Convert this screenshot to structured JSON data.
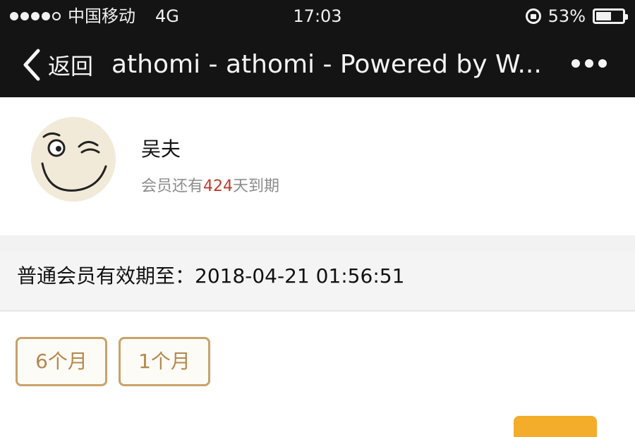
{
  "status_bar": {
    "carrier": "中国移动",
    "network": "4G",
    "time": "17:03",
    "battery_percent": "53%",
    "battery_level": 0.53,
    "icons": [
      "signal-dots-icon",
      "rotation-lock-icon",
      "battery-icon"
    ]
  },
  "nav": {
    "back_label": "返回",
    "title": "athomi - athomi - Powered by W...",
    "icons": [
      "back-chevron-icon",
      "more-dots-icon"
    ]
  },
  "profile": {
    "name": "吴夫",
    "member_prefix": "会员还有",
    "member_days": "424",
    "member_suffix": "天到期"
  },
  "validity": {
    "text": "普通会员有效期至：2018-04-21 01:56:51"
  },
  "plans": [
    {
      "label": "6个月"
    },
    {
      "label": "1个月"
    }
  ],
  "colors": {
    "bar_bg": "#141414",
    "accent": "#c9a26a",
    "days_highlight": "#c0392b",
    "action_button": "#f3ad2a"
  }
}
